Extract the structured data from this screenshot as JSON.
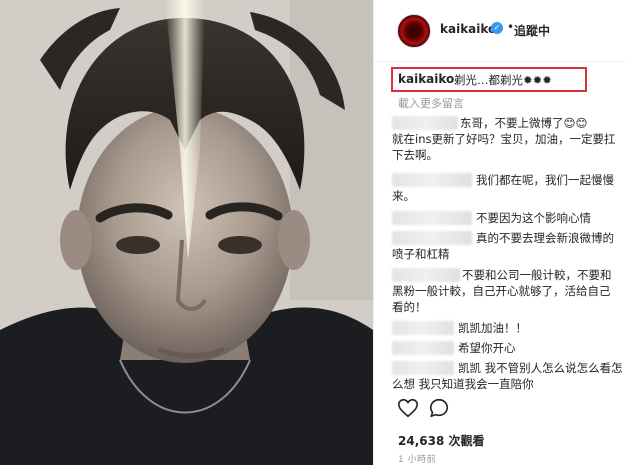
{
  "header": {
    "username": "kaikaiko",
    "verified_icon": "verified-badge-icon",
    "separator": "•",
    "follow_status": "追蹤中"
  },
  "caption": {
    "username": "kaikaiko",
    "text": "剃光…都剃光✹✹✹"
  },
  "load_more": "載入更多留言",
  "comments": [
    {
      "lines": [
        "东哥，不要上微博了😊😊",
        "就在ins更新了好吗？宝贝，加油，一定要扛",
        "下去啊。"
      ]
    },
    {
      "lines": [
        "我们都在呢，我们一起慢慢",
        "来。"
      ]
    },
    {
      "lines": [
        "不要因为这个影响心情"
      ]
    },
    {
      "lines": [
        "真的不要去理会新浪微博的",
        "喷子和杠精"
      ]
    },
    {
      "lines": [
        "不要和公司一般计較，不要和",
        "黑粉一般计較，自己开心就够了，活给自己",
        "看的！"
      ]
    },
    {
      "lines": [
        "凯凯加油！！"
      ]
    },
    {
      "lines": [
        "希望你开心"
      ]
    },
    {
      "lines": [
        "凯凯 我不管别人怎么说怎么看怎",
        "么想 我只知道我会一直陪你"
      ]
    }
  ],
  "actions": {
    "like_icon": "heart-icon",
    "comment_icon": "comment-bubble-icon"
  },
  "views": "24,638 次觀看",
  "time_ago": "1 小時前"
}
